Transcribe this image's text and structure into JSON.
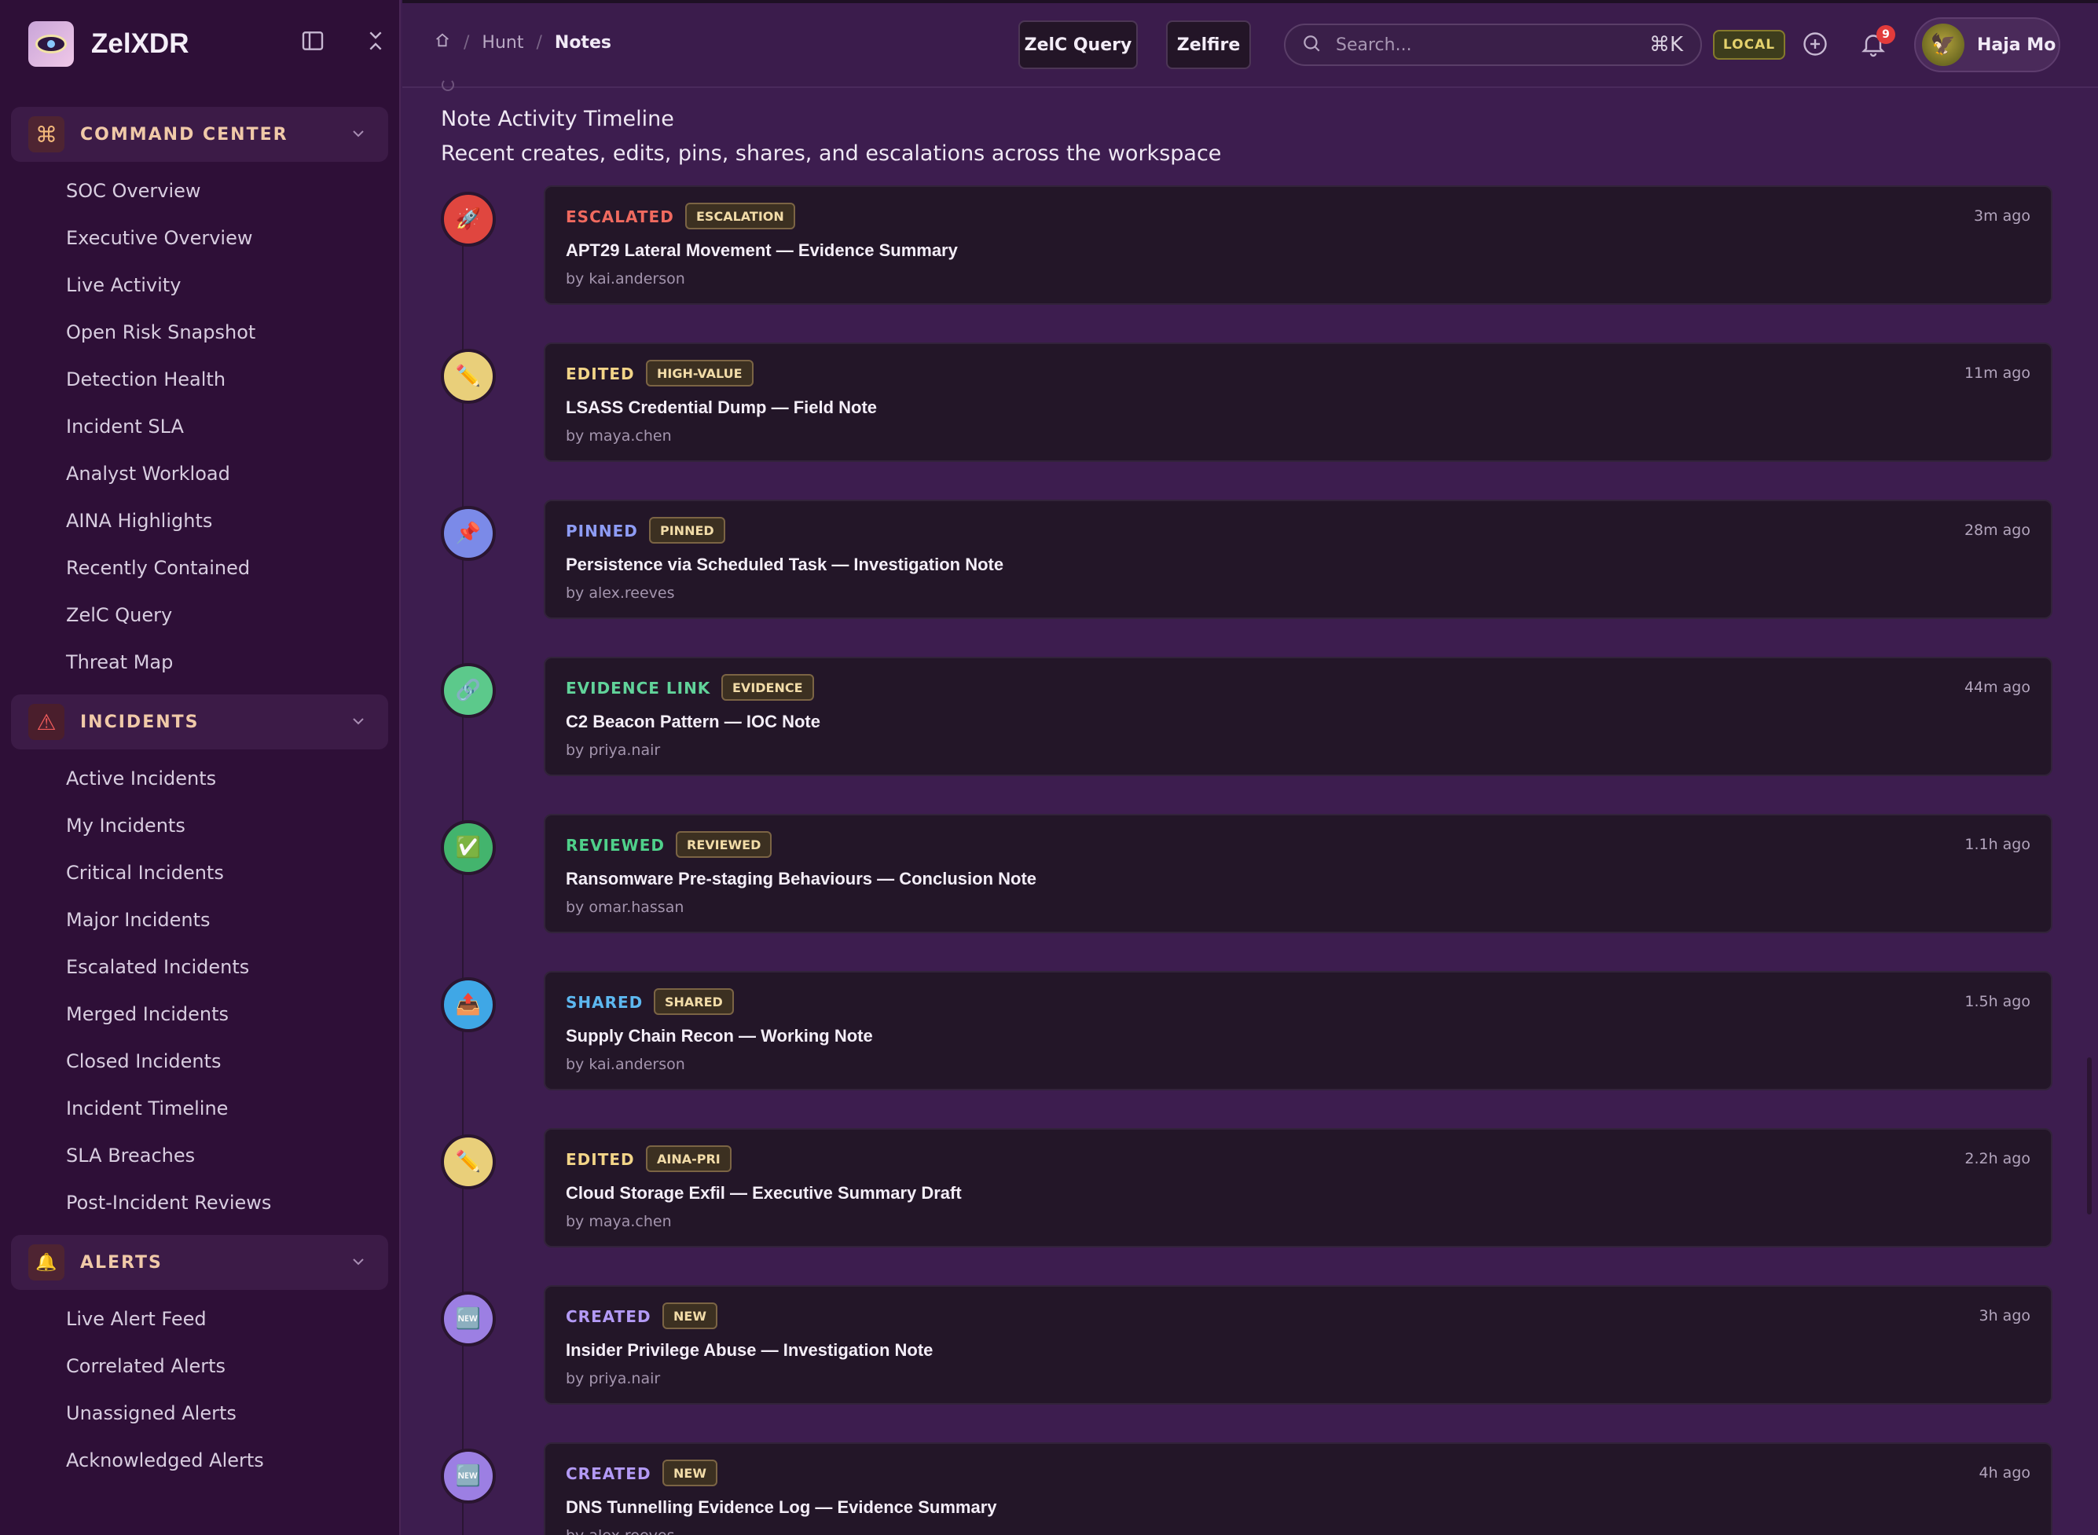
{
  "app": {
    "name": "ZelXDR"
  },
  "sidebar": {
    "sections": [
      {
        "label": "COMMAND CENTER",
        "icon": "command-icon",
        "items": [
          "SOC Overview",
          "Executive Overview",
          "Live Activity",
          "Open Risk Snapshot",
          "Detection Health",
          "Incident SLA",
          "Analyst Workload",
          "AINA Highlights",
          "Recently Contained",
          "ZelC Query",
          "Threat Map"
        ]
      },
      {
        "label": "INCIDENTS",
        "icon": "warning-icon",
        "items": [
          "Active Incidents",
          "My Incidents",
          "Critical Incidents",
          "Major Incidents",
          "Escalated Incidents",
          "Merged Incidents",
          "Closed Incidents",
          "Incident Timeline",
          "SLA Breaches",
          "Post-Incident Reviews"
        ]
      },
      {
        "label": "ALERTS",
        "icon": "bell-icon",
        "items": [
          "Live Alert Feed",
          "Correlated Alerts",
          "Unassigned Alerts",
          "Acknowledged Alerts"
        ]
      }
    ]
  },
  "header": {
    "breadcrumb": [
      "Hunt",
      "Notes"
    ],
    "buttons": {
      "query": "ZelC Query",
      "fire": "Zelfire"
    },
    "search": {
      "placeholder": "Search...",
      "shortcut": "⌘K"
    },
    "env_badge": "LOCAL",
    "notifications_count": "9",
    "user": {
      "name": "Haja Mo"
    }
  },
  "timeline": {
    "title": "Note Activity Timeline",
    "subtitle": "Recent creates, edits, pins, shares, and escalations across the workspace",
    "entries": [
      {
        "action": "ESCALATED",
        "badge": "ESCALATION",
        "title": "APT29 Lateral Movement — Evidence Summary",
        "author": "by kai.anderson",
        "time": "3m ago",
        "color": "#e0463f",
        "action_color": "#f06a5f",
        "icon": "rocket-icon",
        "glyph": "🚀"
      },
      {
        "action": "EDITED",
        "badge": "HIGH-VALUE",
        "title": "LSASS Credential Dump — Field Note",
        "author": "by maya.chen",
        "time": "11m ago",
        "color": "#e9cf7a",
        "action_color": "#f2d488",
        "icon": "pencil-icon",
        "glyph": "✏️"
      },
      {
        "action": "PINNED",
        "badge": "PINNED",
        "title": "Persistence via Scheduled Task — Investigation Note",
        "author": "by alex.reeves",
        "time": "28m ago",
        "color": "#7b8ae8",
        "action_color": "#8e9cf5",
        "icon": "pin-icon",
        "glyph": "📌"
      },
      {
        "action": "EVIDENCE LINK",
        "badge": "EVIDENCE",
        "title": "C2 Beacon Pattern — IOC Note",
        "author": "by priya.nair",
        "time": "44m ago",
        "color": "#5cc98b",
        "action_color": "#61d39a",
        "icon": "link-icon",
        "glyph": "🔗"
      },
      {
        "action": "REVIEWED",
        "badge": "REVIEWED",
        "title": "Ransomware Pre-staging Behaviours — Conclusion Note",
        "author": "by omar.hassan",
        "time": "1.1h ago",
        "color": "#43b46d",
        "action_color": "#4fd08a",
        "icon": "check-icon",
        "glyph": "✅"
      },
      {
        "action": "SHARED",
        "badge": "SHARED",
        "title": "Supply Chain Recon — Working Note",
        "author": "by kai.anderson",
        "time": "1.5h ago",
        "color": "#3fa7e6",
        "action_color": "#5db8f0",
        "icon": "share-icon",
        "glyph": "📤"
      },
      {
        "action": "EDITED",
        "badge": "AINA-PRI",
        "title": "Cloud Storage Exfil — Executive Summary Draft",
        "author": "by maya.chen",
        "time": "2.2h ago",
        "color": "#e9cf7a",
        "action_color": "#f2d488",
        "icon": "pencil-icon",
        "glyph": "✏️"
      },
      {
        "action": "CREATED",
        "badge": "NEW",
        "title": "Insider Privilege Abuse — Investigation Note",
        "author": "by priya.nair",
        "time": "3h ago",
        "color": "#9c7fe3",
        "action_color": "#b39af5",
        "icon": "new-icon",
        "glyph": "🆕"
      },
      {
        "action": "CREATED",
        "badge": "NEW",
        "title": "DNS Tunnelling Evidence Log — Evidence Summary",
        "author": "by alex.reeves",
        "time": "4h ago",
        "color": "#9c7fe3",
        "action_color": "#b39af5",
        "icon": "new-icon",
        "glyph": "🆕"
      }
    ]
  }
}
